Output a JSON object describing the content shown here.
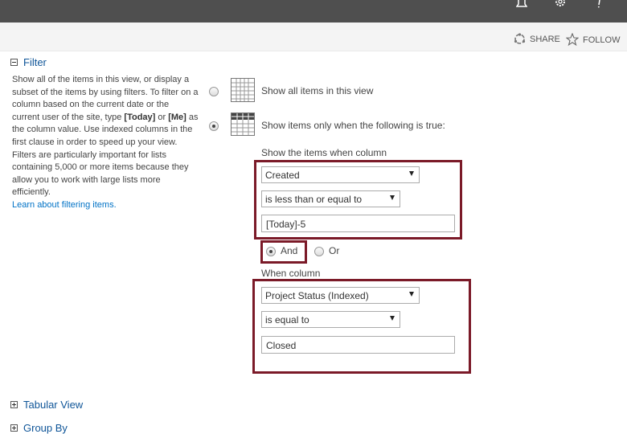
{
  "subbar": {
    "share_label": "SHARE",
    "follow_label": "FOLLOW"
  },
  "filter": {
    "title": "Filter",
    "description": {
      "p1": "Show all of the items in this view, or display a subset of the items by using filters. To filter on a column based on the current date or the current user of the site, type ",
      "today": "[Today]",
      "or": " or ",
      "me": "[Me]",
      "p2": " as the column value. Use indexed columns in the first clause in order to speed up your view. Filters are particularly important for lists containing 5,000 or more items because they allow you to work with large lists more efficiently.",
      "link": "Learn about filtering items."
    },
    "option_all": "Show all items in this view",
    "option_when": "Show items only when the following is true:",
    "show_items_label": "Show the items when column",
    "clause1": {
      "column": "Created",
      "operator": "is less than or equal to",
      "value": "[Today]-5"
    },
    "and_label": "And",
    "or_label": "Or",
    "when_column_label": "When column",
    "clause2": {
      "column": "Project Status (Indexed)",
      "operator": "is equal to",
      "value": "Closed"
    }
  },
  "sections": {
    "tabular_view": "Tabular View",
    "group_by": "Group By"
  },
  "colors": {
    "highlight": "#7b1a28",
    "link": "#0072c6",
    "topbar": "#4f4f4f"
  },
  "icons": [
    "bell-icon",
    "gear-icon",
    "help-icon",
    "share-icon",
    "follow-star-icon",
    "collapse-icon",
    "expand-icon",
    "grid-icon",
    "grid-header-icon"
  ]
}
